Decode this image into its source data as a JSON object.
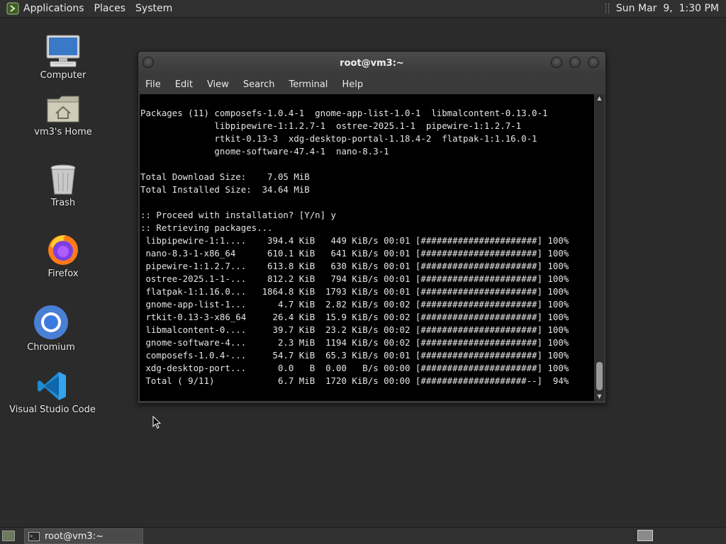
{
  "top_panel": {
    "menus": [
      "Applications",
      "Places",
      "System"
    ],
    "clock": "Sun Mar  9,  1:30 PM"
  },
  "desktop_icons": [
    {
      "label": "Computer",
      "icon": "computer-icon"
    },
    {
      "label": "vm3's Home",
      "icon": "home-folder-icon"
    },
    {
      "label": "Trash",
      "icon": "trash-icon"
    },
    {
      "label": "Firefox",
      "icon": "firefox-icon"
    },
    {
      "label": "Chromium",
      "icon": "chromium-icon"
    },
    {
      "label": "Visual Studio Code",
      "icon": "vscode-icon"
    }
  ],
  "terminal": {
    "title": "root@vm3:~",
    "menus": [
      "File",
      "Edit",
      "View",
      "Search",
      "Terminal",
      "Help"
    ],
    "output": "\nPackages (11) composefs-1.0.4-1  gnome-app-list-1.0-1  libmalcontent-0.13.0-1\n              libpipewire-1:1.2.7-1  ostree-2025.1-1  pipewire-1:1.2.7-1\n              rtkit-0.13-3  xdg-desktop-portal-1.18.4-2  flatpak-1:1.16.0-1\n              gnome-software-47.4-1  nano-8.3-1\n\nTotal Download Size:    7.05 MiB\nTotal Installed Size:  34.64 MiB\n\n:: Proceed with installation? [Y/n] y\n:: Retrieving packages...\n libpipewire-1:1....    394.4 KiB   449 KiB/s 00:01 [######################] 100%\n nano-8.3-1-x86_64      610.1 KiB   641 KiB/s 00:01 [######################] 100%\n pipewire-1:1.2.7...    613.8 KiB   630 KiB/s 00:01 [######################] 100%\n ostree-2025.1-1-...    812.2 KiB   794 KiB/s 00:01 [######################] 100%\n flatpak-1:1.16.0...   1864.8 KiB  1793 KiB/s 00:01 [######################] 100%\n gnome-app-list-1...      4.7 KiB  2.82 KiB/s 00:02 [######################] 100%\n rtkit-0.13-3-x86_64     26.4 KiB  15.9 KiB/s 00:02 [######################] 100%\n libmalcontent-0....     39.7 KiB  23.2 KiB/s 00:02 [######################] 100%\n gnome-software-4...      2.3 MiB  1194 KiB/s 00:02 [######################] 100%\n composefs-1.0.4-...     54.7 KiB  65.3 KiB/s 00:01 [######################] 100%\n xdg-desktop-port...      0.0   B  0.00   B/s 00:00 [######################] 100%\n Total ( 9/11)            6.7 MiB  1720 KiB/s 00:00 [####################--]  94%"
  },
  "taskbar": {
    "task_label": "root@vm3:~"
  }
}
